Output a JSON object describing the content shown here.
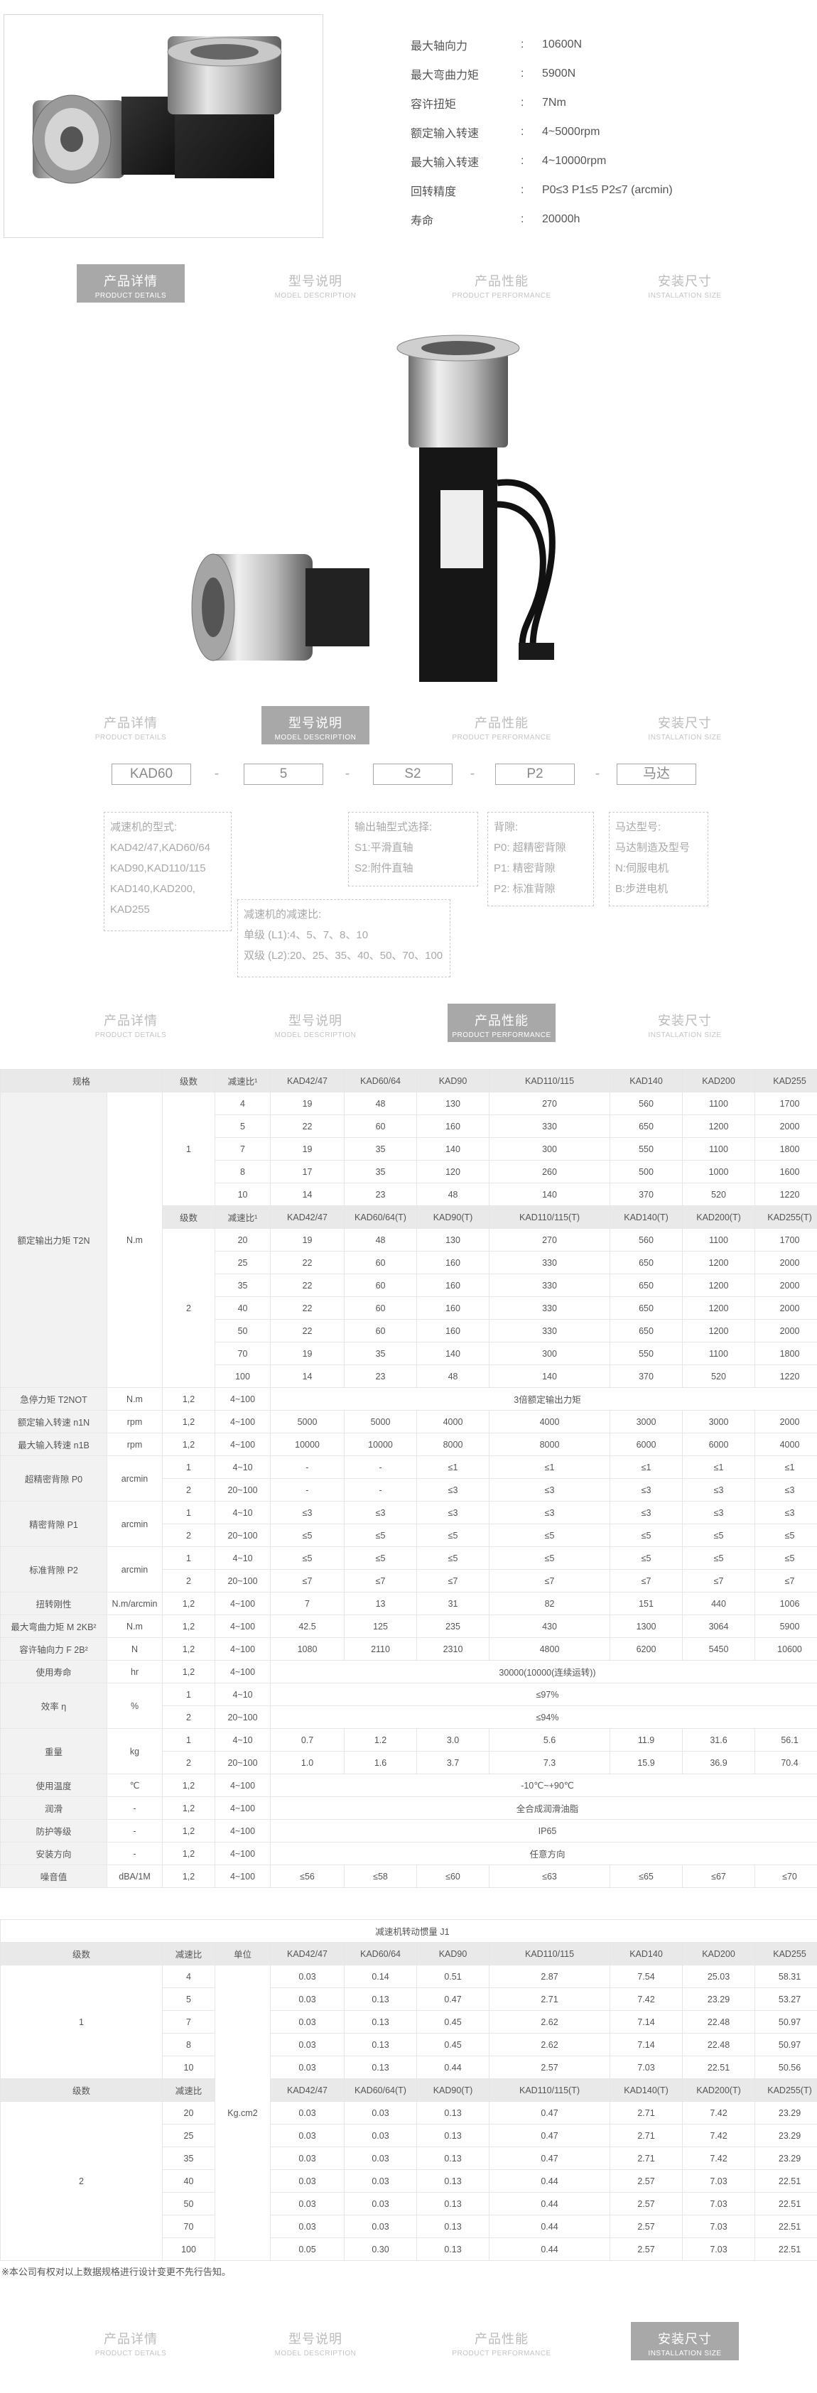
{
  "spec_list": [
    {
      "label": "最大轴向力",
      "value": "10600N"
    },
    {
      "label": "最大弯曲力矩",
      "value": "5900N"
    },
    {
      "label": "容许扭矩",
      "value": "7Nm"
    },
    {
      "label": "额定输入转速",
      "value": "4~5000rpm"
    },
    {
      "label": "最大输入转速",
      "value": "4~10000rpm"
    },
    {
      "label": "回转精度",
      "value": "P0≤3 P1≤5 P2≤7 (arcmin)"
    },
    {
      "label": "寿命",
      "value": "20000h"
    }
  ],
  "colon": ":",
  "tabs": [
    {
      "label": "产品详情",
      "sub": "PRODUCT DETAILS"
    },
    {
      "label": "型号说明",
      "sub": "MODEL DESCRIPTION"
    },
    {
      "label": "产品性能",
      "sub": "PRODUCT PERFORMANCE"
    },
    {
      "label": "安装尺寸",
      "sub": "INSTALLATION SIZE"
    }
  ],
  "model": {
    "codes": [
      "KAD60",
      "5",
      "S2",
      "P2",
      "马达"
    ],
    "dash": "-",
    "desc_a": [
      "减速机的型式:",
      "KAD42/47,KAD60/64",
      "KAD90,KAD110/115",
      "KAD140,KAD200,",
      "KAD255"
    ],
    "desc_b": [
      "减速机的减速比:",
      "单级 (L1):4、5、7、8、10",
      "双级 (L2):20、25、35、40、50、70、100"
    ],
    "desc_c": [
      "输出轴型式选择:",
      "S1:平滑直轴",
      "S2:附件直轴"
    ],
    "desc_d": [
      "背隙:",
      "P0: 超精密背隙",
      "P1: 精密背隙",
      "P2: 标准背隙"
    ],
    "desc_e": [
      "马达型号:",
      "马达制造及型号",
      "N:伺服电机",
      "B:步进电机"
    ]
  },
  "perf": {
    "h_spec": "规格",
    "h_stage": "级数",
    "h_ratio": "减速比¹",
    "models1": [
      "KAD42/47",
      "KAD60/64",
      "KAD90",
      "KAD110/115",
      "KAD140",
      "KAD200",
      "KAD255"
    ],
    "models2": [
      "KAD42/47",
      "KAD60/64(T)",
      "KAD90(T)",
      "KAD110/115(T)",
      "KAD140(T)",
      "KAD200(T)",
      "KAD255(T)"
    ],
    "torque_label": "额定输出力矩 T2N",
    "torque_unit": "N.m",
    "stage1": "1",
    "stage2": "2",
    "torque1": [
      {
        "r": "4",
        "v": [
          "19",
          "48",
          "130",
          "270",
          "560",
          "1100",
          "1700"
        ]
      },
      {
        "r": "5",
        "v": [
          "22",
          "60",
          "160",
          "330",
          "650",
          "1200",
          "2000"
        ]
      },
      {
        "r": "7",
        "v": [
          "19",
          "35",
          "140",
          "300",
          "550",
          "1100",
          "1800"
        ]
      },
      {
        "r": "8",
        "v": [
          "17",
          "35",
          "120",
          "260",
          "500",
          "1000",
          "1600"
        ]
      },
      {
        "r": "10",
        "v": [
          "14",
          "23",
          "48",
          "140",
          "370",
          "520",
          "1220"
        ]
      }
    ],
    "torque2": [
      {
        "r": "20",
        "v": [
          "19",
          "48",
          "130",
          "270",
          "560",
          "1100",
          "1700"
        ]
      },
      {
        "r": "25",
        "v": [
          "22",
          "60",
          "160",
          "330",
          "650",
          "1200",
          "2000"
        ]
      },
      {
        "r": "35",
        "v": [
          "22",
          "60",
          "160",
          "330",
          "650",
          "1200",
          "2000"
        ]
      },
      {
        "r": "40",
        "v": [
          "22",
          "60",
          "160",
          "330",
          "650",
          "1200",
          "2000"
        ]
      },
      {
        "r": "50",
        "v": [
          "22",
          "60",
          "160",
          "330",
          "650",
          "1200",
          "2000"
        ]
      },
      {
        "r": "70",
        "v": [
          "19",
          "35",
          "140",
          "300",
          "550",
          "1100",
          "1800"
        ]
      },
      {
        "r": "100",
        "v": [
          "14",
          "23",
          "48",
          "140",
          "370",
          "520",
          "1220"
        ]
      }
    ],
    "rows": [
      {
        "a": "急停力矩 T2NOT",
        "u": "N.m",
        "s": "1,2",
        "r": "4~100",
        "span": "3倍额定输出力矩"
      },
      {
        "a": "额定输入转速 n1N",
        "u": "rpm",
        "s": "1,2",
        "r": "4~100",
        "v": [
          "5000",
          "5000",
          "4000",
          "4000",
          "3000",
          "3000",
          "2000"
        ]
      },
      {
        "a": "最大输入转速 n1B",
        "u": "rpm",
        "s": "1,2",
        "r": "4~100",
        "v": [
          "10000",
          "10000",
          "8000",
          "8000",
          "6000",
          "6000",
          "4000"
        ]
      }
    ],
    "backlash": [
      {
        "a": "超精密背隙 P0",
        "u": "arcmin",
        "rows": [
          {
            "s": "1",
            "r": "4~10",
            "v": [
              "-",
              "-",
              "≤1",
              "≤1",
              "≤1",
              "≤1",
              "≤1"
            ]
          },
          {
            "s": "2",
            "r": "20~100",
            "v": [
              "-",
              "-",
              "≤3",
              "≤3",
              "≤3",
              "≤3",
              "≤3"
            ]
          }
        ]
      },
      {
        "a": "精密背隙 P1",
        "u": "arcmin",
        "rows": [
          {
            "s": "1",
            "r": "4~10",
            "v": [
              "≤3",
              "≤3",
              "≤3",
              "≤3",
              "≤3",
              "≤3",
              "≤3"
            ]
          },
          {
            "s": "2",
            "r": "20~100",
            "v": [
              "≤5",
              "≤5",
              "≤5",
              "≤5",
              "≤5",
              "≤5",
              "≤5"
            ]
          }
        ]
      },
      {
        "a": "标准背隙 P2",
        "u": "arcmin",
        "rows": [
          {
            "s": "1",
            "r": "4~10",
            "v": [
              "≤5",
              "≤5",
              "≤5",
              "≤5",
              "≤5",
              "≤5",
              "≤5"
            ]
          },
          {
            "s": "2",
            "r": "20~100",
            "v": [
              "≤7",
              "≤7",
              "≤7",
              "≤7",
              "≤7",
              "≤7",
              "≤7"
            ]
          }
        ]
      }
    ],
    "rows2": [
      {
        "a": "扭转刚性",
        "u": "N.m/arcmin",
        "s": "1,2",
        "r": "4~100",
        "v": [
          "7",
          "13",
          "31",
          "82",
          "151",
          "440",
          "1006"
        ]
      },
      {
        "a": "最大弯曲力矩 M 2KB²",
        "u": "N.m",
        "s": "1,2",
        "r": "4~100",
        "v": [
          "42.5",
          "125",
          "235",
          "430",
          "1300",
          "3064",
          "5900"
        ]
      },
      {
        "a": "容许轴向力 F 2B²",
        "u": "N",
        "s": "1,2",
        "r": "4~100",
        "v": [
          "1080",
          "2110",
          "2310",
          "4800",
          "6200",
          "5450",
          "10600"
        ]
      },
      {
        "a": "使用寿命",
        "u": "hr",
        "s": "1,2",
        "r": "4~100",
        "span": "30000(10000(连续运转))"
      }
    ],
    "eff": {
      "a": "效率 η",
      "u": "%",
      "r1": {
        "s": "1",
        "r": "4~10",
        "span": "≤97%"
      },
      "r2": {
        "s": "2",
        "r": "20~100",
        "span": "≤94%"
      }
    },
    "weight": {
      "a": "重量",
      "u": "kg",
      "r1": {
        "s": "1",
        "r": "4~10",
        "v": [
          "0.7",
          "1.2",
          "3.0",
          "5.6",
          "11.9",
          "31.6",
          "56.1"
        ]
      },
      "r2": {
        "s": "2",
        "r": "20~100",
        "v": [
          "1.0",
          "1.6",
          "3.7",
          "7.3",
          "15.9",
          "36.9",
          "70.4"
        ]
      }
    },
    "rows3": [
      {
        "a": "使用温度",
        "u": "℃",
        "s": "1,2",
        "r": "4~100",
        "span": "-10℃~+90℃"
      },
      {
        "a": "润滑",
        "u": "-",
        "s": "1,2",
        "r": "4~100",
        "span": "全合成润滑油脂"
      },
      {
        "a": "防护等级",
        "u": "-",
        "s": "1,2",
        "r": "4~100",
        "span": "IP65"
      },
      {
        "a": "安装方向",
        "u": "-",
        "s": "1,2",
        "r": "4~100",
        "span": "任意方向"
      }
    ],
    "noise": {
      "a": "噪音值",
      "u": "dBA/1M",
      "s": "1,2",
      "r": "4~100",
      "v": [
        "≤56",
        "≤58",
        "≤60",
        "≤63",
        "≤65",
        "≤67",
        "≤70"
      ]
    }
  },
  "inertia": {
    "title": "减速机转动惯量 J1",
    "h_stage": "级数",
    "h_ratio": "减速比",
    "h_unit": "单位",
    "unit": "Kg.cm2",
    "models1": [
      "KAD42/47",
      "KAD60/64",
      "KAD90",
      "KAD110/115",
      "KAD140",
      "KAD200",
      "KAD255"
    ],
    "models2": [
      "KAD42/47",
      "KAD60/64(T)",
      "KAD90(T)",
      "KAD110/115(T)",
      "KAD140(T)",
      "KAD200(T)",
      "KAD255(T)"
    ],
    "stage1": "1",
    "stage2": "2",
    "g1": [
      {
        "r": "4",
        "v": [
          "0.03",
          "0.14",
          "0.51",
          "2.87",
          "7.54",
          "25.03",
          "58.31"
        ]
      },
      {
        "r": "5",
        "v": [
          "0.03",
          "0.13",
          "0.47",
          "2.71",
          "7.42",
          "23.29",
          "53.27"
        ]
      },
      {
        "r": "7",
        "v": [
          "0.03",
          "0.13",
          "0.45",
          "2.62",
          "7.14",
          "22.48",
          "50.97"
        ]
      },
      {
        "r": "8",
        "v": [
          "0.03",
          "0.13",
          "0.45",
          "2.62",
          "7.14",
          "22.48",
          "50.97"
        ]
      },
      {
        "r": "10",
        "v": [
          "0.03",
          "0.13",
          "0.44",
          "2.57",
          "7.03",
          "22.51",
          "50.56"
        ]
      }
    ],
    "g2": [
      {
        "r": "20",
        "v": [
          "0.03",
          "0.03",
          "0.13",
          "0.47",
          "2.71",
          "7.42",
          "23.29"
        ]
      },
      {
        "r": "25",
        "v": [
          "0.03",
          "0.03",
          "0.13",
          "0.47",
          "2.71",
          "7.42",
          "23.29"
        ]
      },
      {
        "r": "35",
        "v": [
          "0.03",
          "0.03",
          "0.13",
          "0.47",
          "2.71",
          "7.42",
          "23.29"
        ]
      },
      {
        "r": "40",
        "v": [
          "0.03",
          "0.03",
          "0.13",
          "0.44",
          "2.57",
          "7.03",
          "22.51"
        ]
      },
      {
        "r": "50",
        "v": [
          "0.03",
          "0.03",
          "0.13",
          "0.44",
          "2.57",
          "7.03",
          "22.51"
        ]
      },
      {
        "r": "70",
        "v": [
          "0.03",
          "0.03",
          "0.13",
          "0.44",
          "2.57",
          "7.03",
          "22.51"
        ]
      },
      {
        "r": "100",
        "v": [
          "0.05",
          "0.30",
          "0.13",
          "0.44",
          "2.57",
          "7.03",
          "22.51"
        ]
      }
    ]
  },
  "footnote": "※本公司有权对以上数据规格进行设计变更不先行告知。"
}
